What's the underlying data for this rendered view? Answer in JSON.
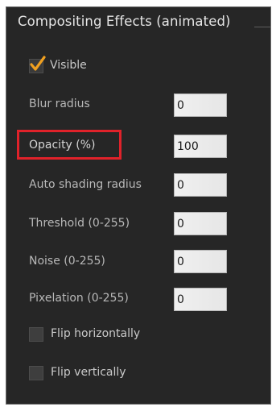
{
  "panel": {
    "title": "Compositing Effects (animated)",
    "visible_label": "Visible",
    "visible_checked": true,
    "fields": [
      {
        "label": "Blur radius",
        "value": "0"
      },
      {
        "label": "Opacity (%)",
        "value": "100"
      },
      {
        "label": "Auto shading radius",
        "value": "0"
      },
      {
        "label": "Threshold (0-255)",
        "value": "0"
      },
      {
        "label": "Noise (0-255)",
        "value": "0"
      },
      {
        "label": "Pixelation (0-255)",
        "value": "0"
      }
    ],
    "flip_horizontal_label": "Flip horizontally",
    "flip_horizontal_checked": false,
    "flip_vertical_label": "Flip vertically",
    "flip_vertical_checked": false
  },
  "colors": {
    "panel_background": "#262626",
    "highlight_border": "#e0222a",
    "checkmark": "#f0a020"
  },
  "icons": {
    "checkmark": "checkmark-icon"
  }
}
